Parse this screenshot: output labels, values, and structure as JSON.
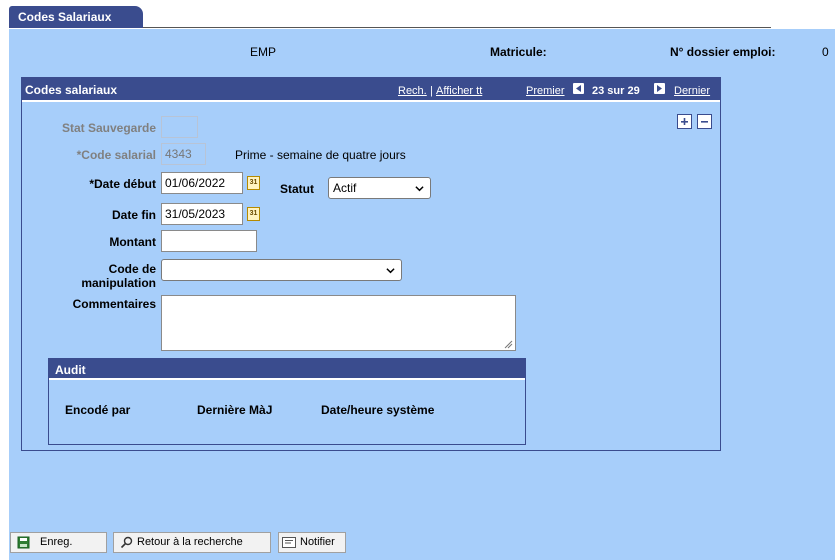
{
  "tab": {
    "label": "Codes Salariaux"
  },
  "header": {
    "emp_label": "EMP",
    "matricule_label": "Matricule:",
    "dossier_label": "N° dossier emploi:",
    "dossier_value": "0"
  },
  "panel": {
    "title": "Codes salariaux",
    "nav": {
      "rech": "Rech.",
      "sep": "|",
      "afficher": "Afficher tt",
      "premier": "Premier",
      "count": "23 sur 29",
      "dernier": "Dernier"
    },
    "form": {
      "stat_label": "Stat Sauvegarde",
      "stat_value": "",
      "code_label": "*Code salarial",
      "code_value": "4343",
      "code_desc": "Prime - semaine de quatre jours",
      "date_debut_label": "*Date début",
      "date_debut_value": "01/06/2022",
      "statut_label": "Statut",
      "statut_value": "Actif",
      "date_fin_label": "Date fin",
      "date_fin_value": "31/05/2023",
      "montant_label": "Montant",
      "montant_value": "",
      "code_manip_label_1": "Code de",
      "code_manip_label_2": "manipulation",
      "code_manip_value": "",
      "commentaires_label": "Commentaires",
      "commentaires_value": ""
    },
    "audit": {
      "title": "Audit",
      "col1": "Encodé par",
      "col2": "Dernière MàJ",
      "col3": "Date/heure système"
    }
  },
  "buttons": {
    "save": "Enreg.",
    "return": "Retour à la recherche",
    "notify": "Notifier"
  },
  "colors": {
    "page_bg": "#a7cefa",
    "header_blue": "#3a4c8e"
  }
}
